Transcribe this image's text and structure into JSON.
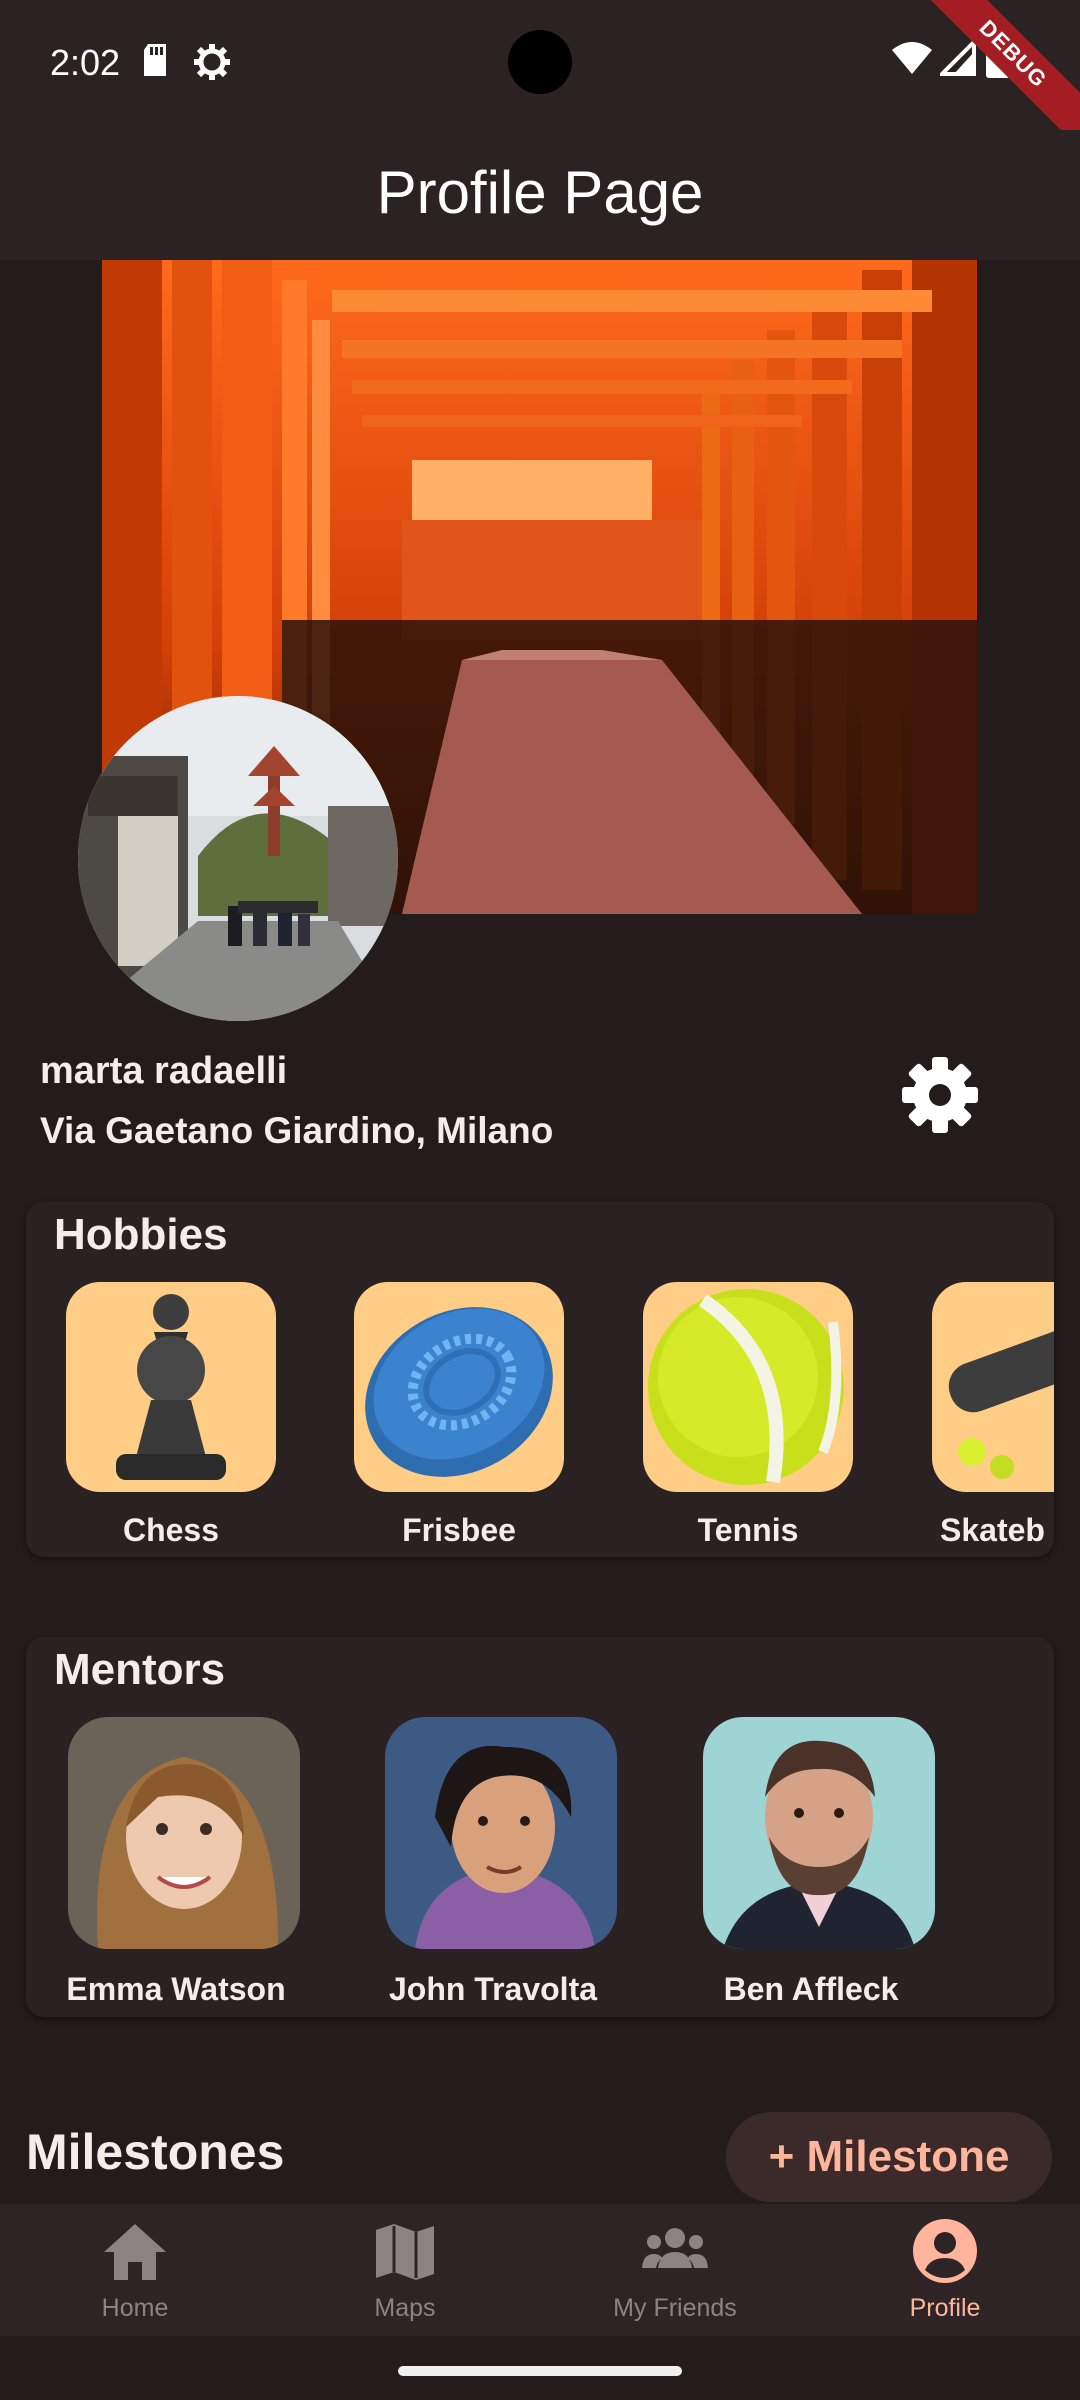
{
  "status_bar": {
    "time": "2:02",
    "debug_label": "DEBUG"
  },
  "app_bar": {
    "title": "Profile Page"
  },
  "profile": {
    "name": "marta radaelli",
    "address": "Via Gaetano Giardino, Milano",
    "settings_icon": "gear-icon"
  },
  "hobbies": {
    "title": "Hobbies",
    "items": [
      {
        "label": "Chess",
        "icon": "chess-pawn-icon"
      },
      {
        "label": "Frisbee",
        "icon": "frisbee-icon"
      },
      {
        "label": "Tennis",
        "icon": "tennis-ball-icon"
      },
      {
        "label": "Skateb",
        "icon": "skateboard-icon"
      }
    ]
  },
  "mentors": {
    "title": "Mentors",
    "items": [
      {
        "name": "Emma Watson"
      },
      {
        "name": "John Travolta"
      },
      {
        "name": "Ben Affleck"
      }
    ]
  },
  "milestones": {
    "title": "Milestones",
    "add_label": "+ Milestone"
  },
  "bottom_nav": {
    "items": [
      {
        "label": "Home",
        "icon": "home-icon"
      },
      {
        "label": "Maps",
        "icon": "map-icon"
      },
      {
        "label": "My Friends",
        "icon": "people-icon"
      },
      {
        "label": "Profile",
        "icon": "account-circle-icon"
      }
    ],
    "active_index": 3
  },
  "colors": {
    "background": "#231b1c",
    "tile": "#ffcd86",
    "accent": "#ffb59b",
    "inactive": "#8c8384"
  }
}
